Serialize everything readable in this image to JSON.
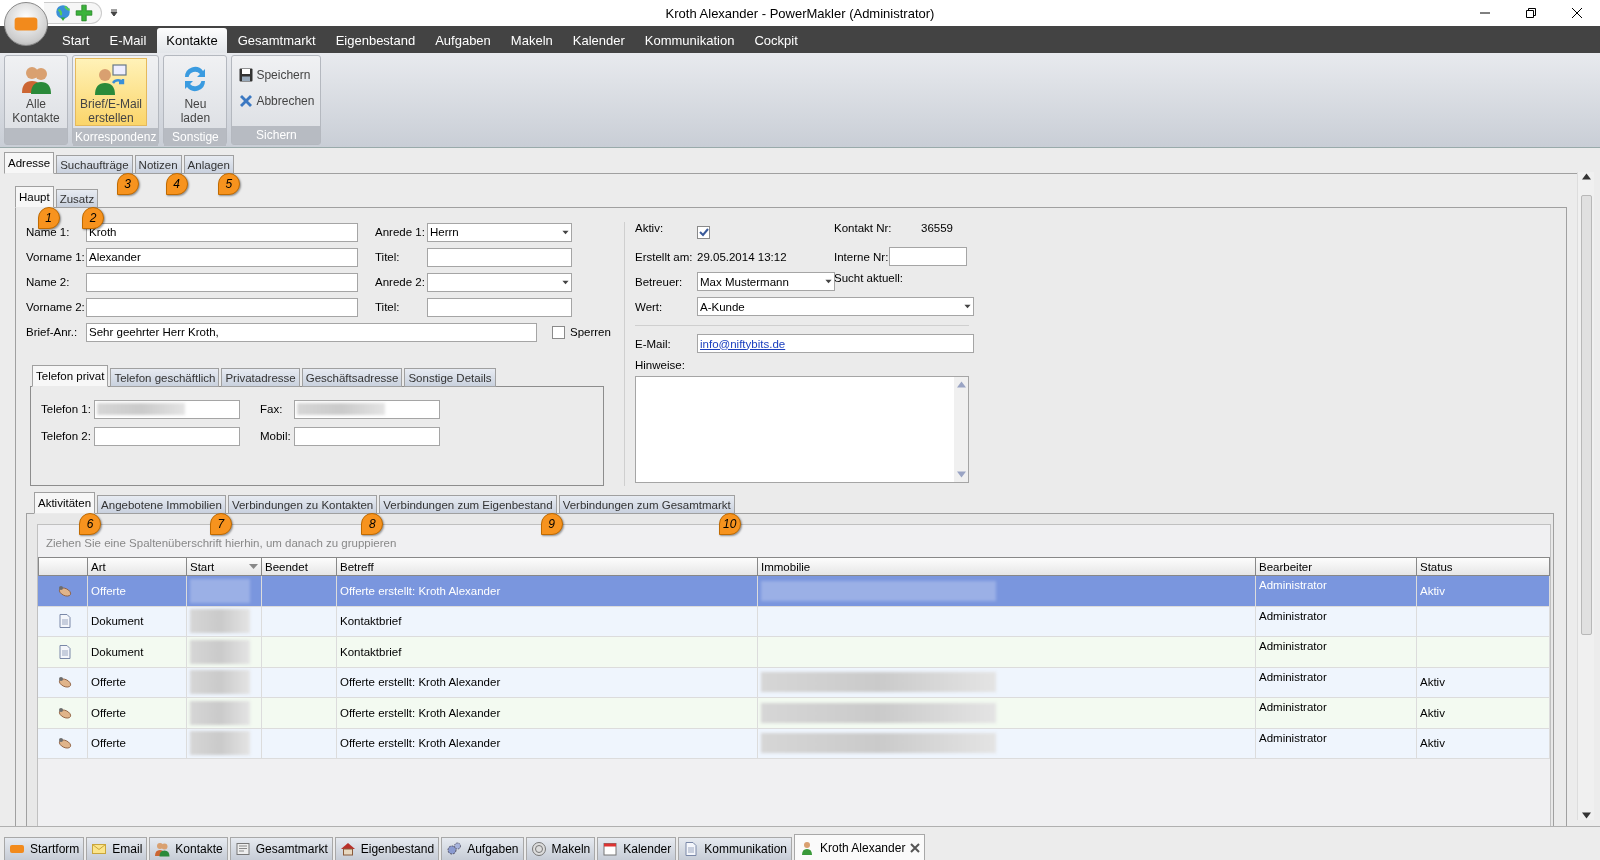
{
  "window": {
    "title": "Kroth Alexander - PowerMakler (Administrator)"
  },
  "menu": [
    {
      "label": "Start",
      "selected": false
    },
    {
      "label": "E-Mail",
      "selected": false
    },
    {
      "label": "Kontakte",
      "selected": true
    },
    {
      "label": "Gesamtmarkt",
      "selected": false
    },
    {
      "label": "Eigenbestand",
      "selected": false
    },
    {
      "label": "Aufgaben",
      "selected": false
    },
    {
      "label": "Makeln",
      "selected": false
    },
    {
      "label": "Kalender",
      "selected": false
    },
    {
      "label": "Kommunikation",
      "selected": false
    },
    {
      "label": "Cockpit",
      "selected": false
    }
  ],
  "ribbon": [
    {
      "buttons": [
        {
          "kind": "large",
          "label": "Alle\nKontakte",
          "highlighted": false
        }
      ]
    },
    {
      "label": "Korrespondenz",
      "buttons": [
        {
          "kind": "large",
          "label": "Brief/E-Mail\nerstellen",
          "highlighted": true
        }
      ]
    },
    {
      "label": "Sonstige",
      "buttons": [
        {
          "kind": "large",
          "label": "Neu\nladen",
          "highlighted": false
        }
      ]
    },
    {
      "label": "Sichern",
      "buttons": [
        {
          "kind": "small",
          "label": "Speichern",
          "highlighted": false
        },
        {
          "kind": "small",
          "label": "Abbrechen",
          "highlighted": false
        }
      ]
    }
  ],
  "doc_tabs": [
    {
      "label": "Adresse",
      "selected": true
    },
    {
      "label": "Suchaufträge",
      "selected": false,
      "callout": "3"
    },
    {
      "label": "Notizen",
      "selected": false,
      "callout": "4"
    },
    {
      "label": "Anlagen",
      "selected": false,
      "callout": "5"
    }
  ],
  "sub_tabs": [
    {
      "label": "Haupt",
      "selected": true,
      "callout": "1"
    },
    {
      "label": "Zusatz",
      "selected": false,
      "callout": "2"
    }
  ],
  "name_rows": [
    [
      {
        "label": "Name 1:",
        "value": "Kroth",
        "kind": "text"
      },
      {
        "label": "Anrede 1:",
        "value": "Herrn",
        "kind": "dropdown"
      }
    ],
    [
      {
        "label": "Vorname 1:",
        "value": "Alexander",
        "kind": "text"
      },
      {
        "label": "Titel:",
        "kind": "text"
      }
    ],
    [
      {
        "label": "Name 2:",
        "kind": "text"
      },
      {
        "label": "Anrede 2:",
        "kind": "dropdown"
      }
    ],
    [
      {
        "label": "Vorname 2:",
        "kind": "text"
      },
      {
        "label": "Titel:",
        "kind": "text"
      }
    ]
  ],
  "brief_anrede": {
    "label": "Brief-Anr.:",
    "value": "Sehr geehrter Herr Kroth,"
  },
  "sperren": {
    "label": "Sperren",
    "checked": false
  },
  "phone_tabs": [
    {
      "label": "Telefon privat",
      "selected": true
    },
    {
      "label": "Telefon geschäftlich",
      "selected": false
    },
    {
      "label": "Privatadresse",
      "selected": false
    },
    {
      "label": "Geschäftsadresse",
      "selected": false
    },
    {
      "label": "Sonstige Details",
      "selected": false
    }
  ],
  "phone_rows": [
    [
      {
        "label": "Telefon 1:",
        "redacted": true
      },
      {
        "label": "Fax:",
        "redacted": true
      }
    ],
    [
      {
        "label": "Telefon 2:",
        "redacted": false
      },
      {
        "label": "Mobil:",
        "redacted": false
      }
    ]
  ],
  "details": {
    "aktiv": {
      "label": "Aktiv:",
      "checked": true
    },
    "kontakt_nr": {
      "label": "Kontakt Nr:",
      "value": "36559"
    },
    "erstellt": {
      "label": "Erstellt am:",
      "value": "29.05.2014 13:12"
    },
    "interne_nr": {
      "label": "Interne Nr:"
    },
    "betreuer": {
      "label": "Betreuer:",
      "value": "Max Mustermann"
    },
    "sucht_aktuell": {
      "label": "Sucht aktuell:"
    },
    "wert": {
      "label": "Wert:",
      "value": "A-Kunde"
    },
    "email": {
      "label": "E-Mail:",
      "value": "info@niftybits.de"
    },
    "hinweise": {
      "label": "Hinweise:"
    }
  },
  "activity_tabs": [
    {
      "label": "Aktivitäten",
      "selected": true,
      "callout": "6"
    },
    {
      "label": "Angebotene Immobilien",
      "selected": false,
      "callout": "7"
    },
    {
      "label": "Verbindungen zu Kontakten",
      "selected": false,
      "callout": "8"
    },
    {
      "label": "Verbindungen zum Eigenbestand",
      "selected": false,
      "callout": "9"
    },
    {
      "label": "Verbindungen zum Gesamtmarkt",
      "selected": false,
      "callout": "10"
    }
  ],
  "grid": {
    "group_hint": "Ziehen Sie eine Spaltenüberschrift hierhin, um danach zu gruppieren",
    "columns": [
      {
        "label": "Art",
        "sorted": false
      },
      {
        "label": "Start",
        "sorted": true
      },
      {
        "label": "Beendet",
        "sorted": false
      },
      {
        "label": "Betreff",
        "sorted": false
      },
      {
        "label": "Immobilie",
        "sorted": false
      },
      {
        "label": "Bearbeiter",
        "sorted": false
      },
      {
        "label": "Status",
        "sorted": false
      }
    ],
    "rows": [
      {
        "kind": "offer",
        "selected": true,
        "art": "Offerte",
        "start_redacted": true,
        "betreff": "Offerte erstellt: Kroth  Alexander",
        "immobilie_redacted": true,
        "bearbeiter": "Administrator",
        "status": "Aktiv"
      },
      {
        "kind": "document",
        "selected": false,
        "art": "Dokument",
        "start_redacted": true,
        "betreff": "Kontaktbrief",
        "immobilie_redacted": false,
        "bearbeiter": "Administrator"
      },
      {
        "kind": "document",
        "selected": false,
        "art": "Dokument",
        "start_redacted": true,
        "betreff": "Kontaktbrief",
        "immobilie_redacted": false,
        "bearbeiter": "Administrator"
      },
      {
        "kind": "offer",
        "selected": false,
        "art": "Offerte",
        "start_redacted": true,
        "betreff": "Offerte erstellt: Kroth  Alexander",
        "immobilie_redacted": true,
        "bearbeiter": "Administrator",
        "status": "Aktiv"
      },
      {
        "kind": "offer",
        "selected": false,
        "art": "Offerte",
        "start_redacted": true,
        "betreff": "Offerte erstellt: Kroth  Alexander",
        "immobilie_redacted": true,
        "bearbeiter": "Administrator",
        "status": "Aktiv"
      },
      {
        "kind": "offer",
        "selected": false,
        "art": "Offerte",
        "start_redacted": true,
        "betreff": "Offerte erstellt: Kroth  Alexander",
        "immobilie_redacted": true,
        "bearbeiter": "Administrator",
        "status": "Aktiv"
      }
    ]
  },
  "taskbar": [
    {
      "label": "Startform",
      "selected": false
    },
    {
      "label": "Email",
      "selected": false
    },
    {
      "label": "Kontakte",
      "selected": false
    },
    {
      "label": "Gesamtmarkt",
      "selected": false
    },
    {
      "label": "Eigenbestand",
      "selected": false
    },
    {
      "label": "Aufgaben",
      "selected": false
    },
    {
      "label": "Makeln",
      "selected": false
    },
    {
      "label": "Kalender",
      "selected": false
    },
    {
      "label": "Kommunikation",
      "selected": false
    },
    {
      "label": "Kroth Alexander",
      "selected": true
    }
  ]
}
